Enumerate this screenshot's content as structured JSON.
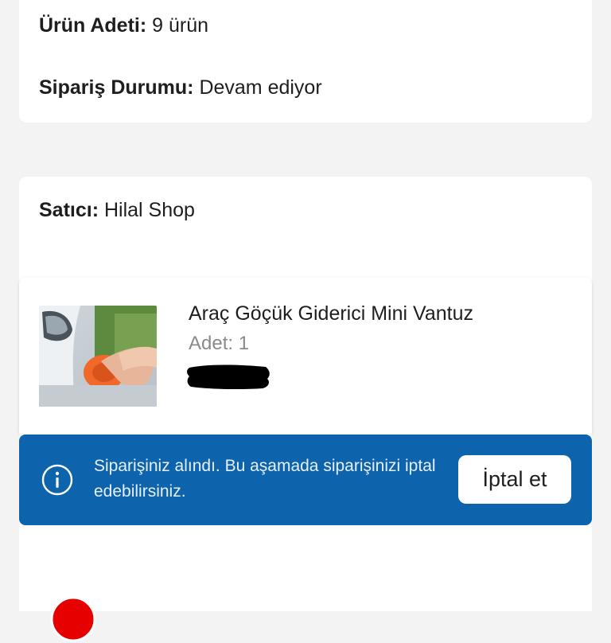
{
  "summary": {
    "item_count_label": "Ürün Adeti:",
    "item_count_value": "9 ürün",
    "status_label": "Sipariş Durumu:",
    "status_value": "Devam ediyor"
  },
  "order": {
    "seller_label": "Satıcı:",
    "seller_value": "Hilal Shop",
    "product": {
      "name": "Araç Göçük Giderici Mini Vantuz",
      "quantity": "Adet: 1"
    }
  },
  "alert": {
    "icon": "info-icon",
    "message": "Siparişiniz alındı. Bu aşamada siparişinizi iptal edebilirsiniz.",
    "cancel_label": "İptal et"
  },
  "colors": {
    "background": "#f3f3f3",
    "alert_bg": "#0d64ad",
    "brand_red": "#e60000"
  }
}
